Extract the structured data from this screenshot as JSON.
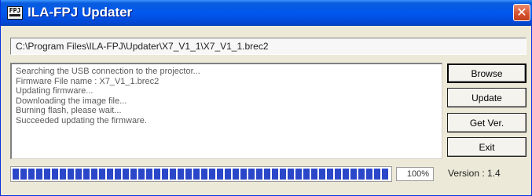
{
  "window": {
    "title": "ILA-FPJ Updater",
    "close_glyph": "✕",
    "icon": "app-fpj-icon"
  },
  "path": {
    "value": "C:\\Program Files\\ILA-FPJ\\Updater\\X7_V1_1\\X7_V1_1.brec2"
  },
  "log": {
    "lines": [
      "Searching the USB connection to the projector...",
      "Firmware File name : X7_V1_1.brec2",
      "Updating firmware...",
      "Downloading the image file...",
      "Burning flash, please wait...",
      "Succeeded updating the firmware."
    ]
  },
  "buttons": {
    "browse": "Browse",
    "update": "Update",
    "get_ver": "Get Ver.",
    "exit": "Exit"
  },
  "progress": {
    "value": 1.0,
    "label": "100%"
  },
  "version": {
    "label": "Version : 1.4"
  },
  "colors": {
    "titlebar": "#0058ee",
    "progress_block": "#2b47c9",
    "close": "#d5512e"
  }
}
